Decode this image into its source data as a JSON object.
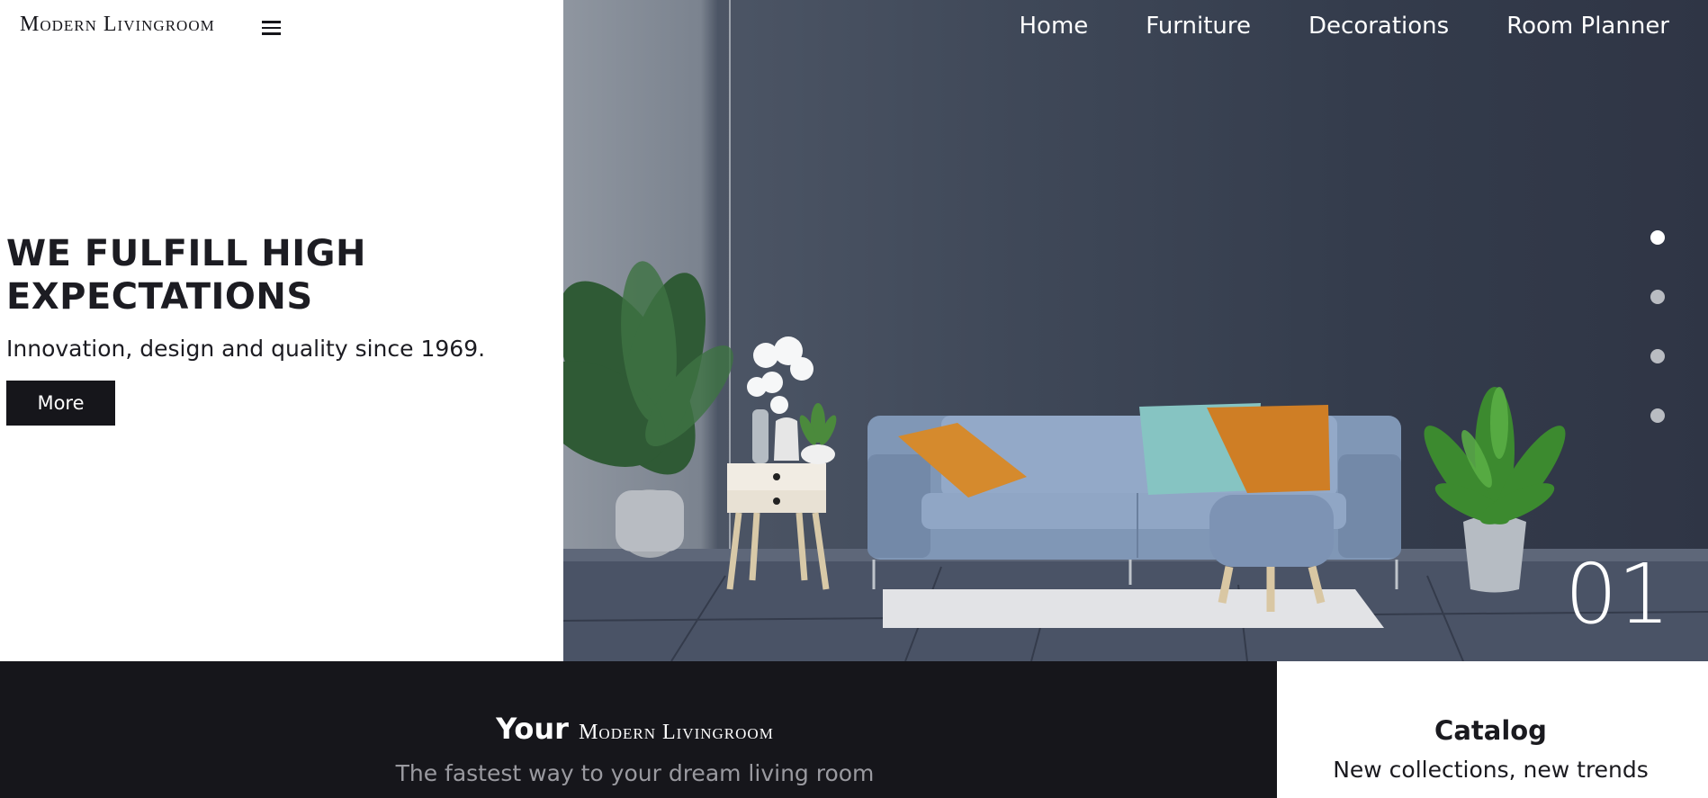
{
  "brand": {
    "logo_text": "Modern Livingroom"
  },
  "nav": {
    "items": [
      "Home",
      "Furniture",
      "Decorations",
      "Room Planner"
    ]
  },
  "hero": {
    "title": "WE FULFILL HIGH EXPECTATIONS",
    "subtitle": "Innovation, design and quality since 1969.",
    "button_label": "More",
    "slide_number": "01",
    "slides": {
      "count": 4,
      "active_index": 0
    }
  },
  "intro": {
    "prefix": "Your",
    "brand": "Modern Livingroom",
    "tagline": "The fastest way to your dream living room"
  },
  "catalog": {
    "title": "Catalog",
    "subtitle": "New collections, new trends"
  },
  "colors": {
    "dark": "#16161b",
    "white": "#ffffff",
    "muted": "#9a9aa0"
  },
  "icons": {
    "menu": "hamburger-menu-icon"
  }
}
